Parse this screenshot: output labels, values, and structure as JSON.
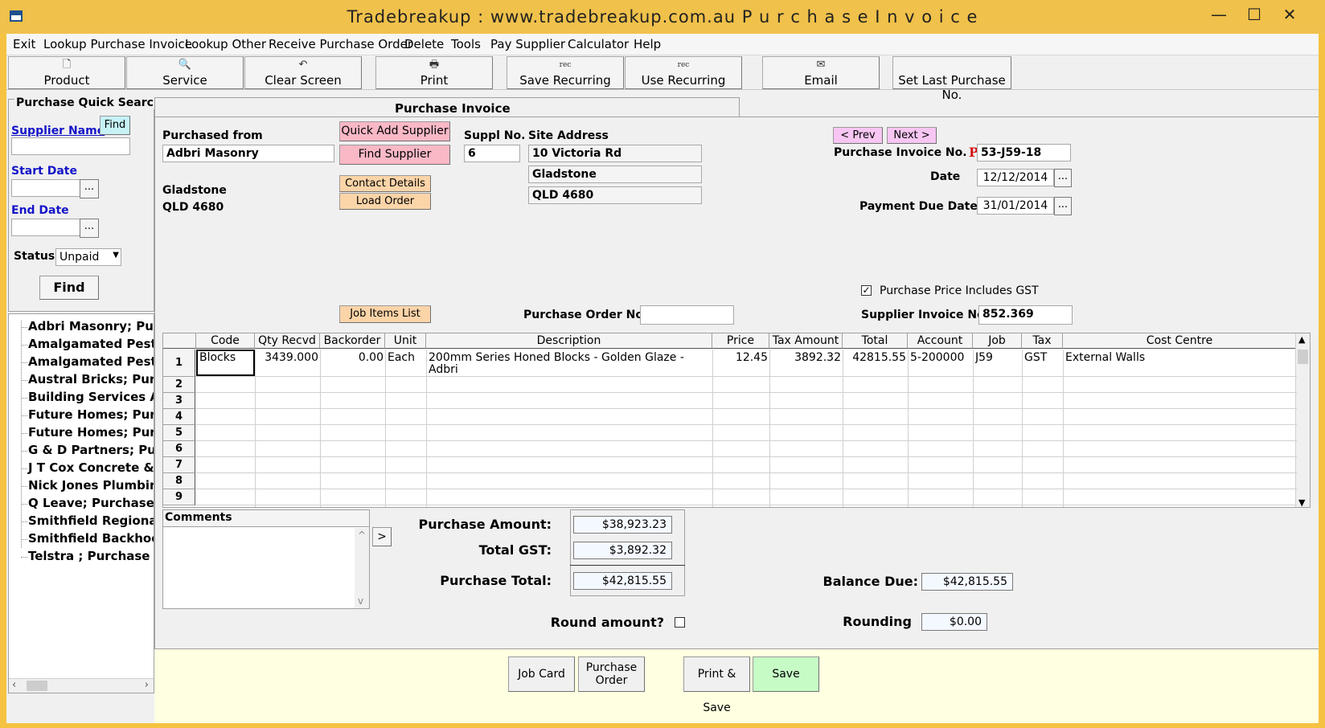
{
  "window": {
    "title": "Tradebreakup :   www.tradebreakup.com.au      P u r c h a s e   I n v o i c e",
    "minimize": "—",
    "maximize": "☐",
    "close": "✕"
  },
  "menu": [
    "Exit",
    "Lookup Purchase Invoice",
    "Lookup Other",
    "Receive Purchase Order",
    "Delete",
    "Tools",
    "Pay Supplier",
    "Calculator",
    "Help"
  ],
  "toolbar": {
    "product": "Product",
    "service": "Service",
    "clear_screen": "Clear Screen",
    "print": "Print",
    "save_recurring": "Save Recurring",
    "use_recurring": "Use Recurring",
    "email": "Email",
    "set_last_purchase": "Set Last Purchase No.",
    "rec_icon": "rec"
  },
  "quick_search": {
    "title": "Purchase Quick Search",
    "supplier_name_label": "Supplier Name",
    "find_small": "Find",
    "supplier_name_value": "",
    "start_date_label": "Start Date",
    "start_date_value": "",
    "end_date_label": "End Date",
    "end_date_value": "",
    "status_label": "Status",
    "status_value": "Unpaid",
    "find_button": "Find",
    "dots": "..."
  },
  "results": [
    "Adbri Masonry; Purchase Invoice",
    "Amalgamated Pest Control; Purchase Invoice",
    "Amalgamated Pest Control; Purchase Invoice",
    "Austral Bricks; Purchase Invoice",
    "Building Services Australia; Purchase Invoice",
    "Future Homes; Purchase Invoice",
    "Future Homes; Purchase Invoice",
    "G & D Partners; Purchase Invoice",
    "J T Cox Concrete & Steel; Purchase Invoice",
    "Nick Jones Plumbing; Purchase Invoice",
    "Q Leave; Purchase Invoice",
    "Smithfield Regional; Purchase Invoice",
    "Smithfield Backhoe Hire; Purchase Invoice",
    "Telstra ; Purchase Invoice"
  ],
  "tab": {
    "label": "Purchase Invoice"
  },
  "supplier": {
    "purchased_from_label": "Purchased from",
    "purchased_from_value": "Adbri Masonry",
    "city": "Gladstone",
    "state_post": "QLD  4680",
    "quick_add": "Quick Add Supplier",
    "find_supplier": "Find Supplier",
    "contact_details": "Contact Details",
    "load_order": "Load Order",
    "suppl_no_label": "Suppl No.",
    "suppl_no_value": "6"
  },
  "site": {
    "label": "Site Address",
    "line1": "10 Victoria Rd",
    "line2": "Gladstone",
    "line3": "QLD  4680"
  },
  "invoice": {
    "prev": "< Prev",
    "next": "Next >",
    "invoice_no_label": "Purchase Invoice No.",
    "prefix": "P",
    "invoice_no_value": "53-J59-18",
    "date_label": "Date",
    "date_value": "12/12/2014",
    "due_label": "Payment Due Date",
    "due_value": "31/01/2014",
    "gst_includes_label": "Purchase Price Includes GST",
    "supplier_invoice_label": "Supplier Invoice No.",
    "supplier_invoice_value": "852.369",
    "po_label": "Purchase Order No.",
    "po_value": "",
    "job_items": "Job Items List"
  },
  "grid": {
    "columns": [
      "Code",
      "Qty Recvd",
      "Backorder",
      "Unit",
      "Description",
      "Price",
      "Tax Amount",
      "Total",
      "Account",
      "Job",
      "Tax",
      "Cost Centre"
    ],
    "rows": [
      {
        "no": "1",
        "code": "Blocks",
        "qty": "3439.000",
        "backorder": "0.00",
        "unit": "Each",
        "desc1": "200mm Series Honed Blocks - Golden Glaze -",
        "desc2": "Adbri",
        "price": "12.45",
        "tax_amount": "3892.32",
        "total": "42815.55",
        "account": "5-200000",
        "job": "J59",
        "tax": "GST",
        "cost_centre": "External Walls"
      }
    ],
    "row_numbers": [
      "1",
      "2",
      "3",
      "4",
      "5",
      "6",
      "7",
      "8",
      "9"
    ]
  },
  "comments": {
    "label": "Comments",
    "value": "",
    "expand": ">"
  },
  "totals": {
    "purchase_amount_label": "Purchase Amount:",
    "purchase_amount": "$38,923.23",
    "total_gst_label": "Total GST:",
    "total_gst": "$3,892.32",
    "purchase_total_label": "Purchase Total:",
    "purchase_total": "$42,815.55",
    "balance_due_label": "Balance Due:",
    "balance_due": "$42,815.55",
    "round_label": "Round amount?",
    "rounding_label": "Rounding",
    "rounding": "$0.00"
  },
  "bottom": {
    "job_card": "Job Card",
    "purchase_order_1": "Purchase",
    "purchase_order_2": "Order",
    "print_save": "Print & Save",
    "save": "Save"
  }
}
